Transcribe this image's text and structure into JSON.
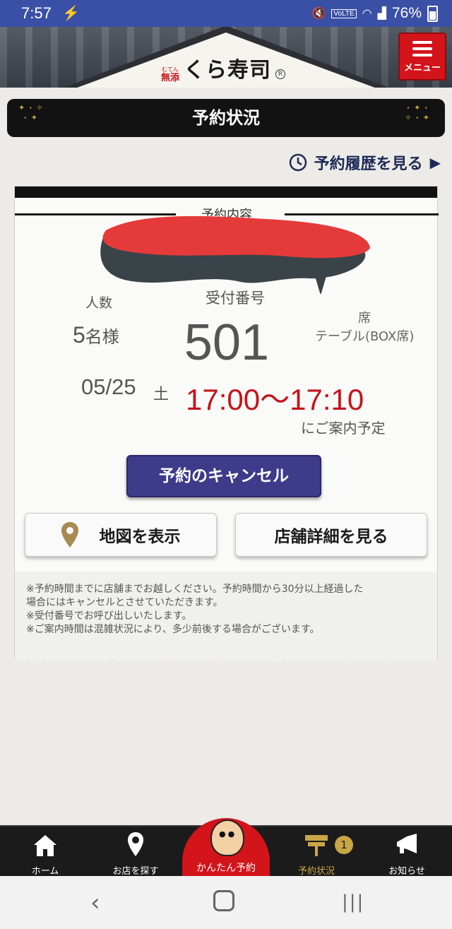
{
  "status_bar": {
    "time": "7:57",
    "battery": "76%",
    "flash_icon": "flash-icon",
    "mute_icon": "mute-icon",
    "volte_label": "VoLTE",
    "wifi_icon": "wifi-icon",
    "signal_icon": "signal-icon"
  },
  "header": {
    "logo_prefix": "無添",
    "logo_ruby": "むてん",
    "logo_text": "くら寿司",
    "logo_mark": "R",
    "menu_label": "メニュー",
    "brand_color": "#d3141b"
  },
  "page": {
    "title": "予約状況",
    "history_link": "予約履歴を見る"
  },
  "reservation": {
    "section_label": "予約内容",
    "people_label": "人数",
    "people_value": "5",
    "people_unit": "名様",
    "number_label": "受付番号",
    "number_value": "501",
    "seat_label": "席",
    "seat_value": "テーブル(BOX席)",
    "date": "05/25",
    "weekday": "土",
    "time_range": "17:00〜17:10",
    "guidance": "にご案内予定",
    "accent_color": "#c3151b"
  },
  "buttons": {
    "cancel": "予約のキャンセル",
    "map": "地図を表示",
    "store_details": "店舗詳細を見る"
  },
  "notes": [
    "※予約時間までに店舗までお越しください。予約時間から30分以上経過した",
    "場合にはキャンセルとさせていただきます。",
    "※受付番号でお呼び出しいたします。",
    "※ご案内時間は混雑状況により、多少前後する場合がございます。"
  ],
  "bottom_nav": {
    "home": "ホーム",
    "find_store": "お店を探す",
    "easy_reserve": "かんたん予約",
    "reservation_status": "予約状況",
    "reservation_badge": "1",
    "notifications": "お知らせ"
  }
}
